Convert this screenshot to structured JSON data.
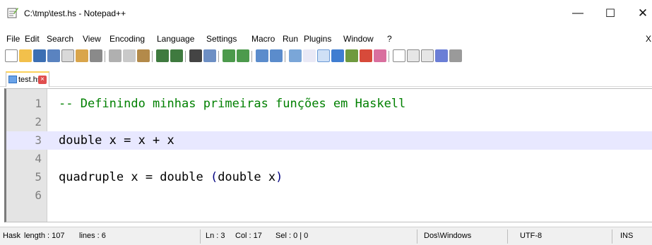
{
  "window": {
    "title": "C:\\tmp\\test.hs - Notepad++",
    "minimize_glyph": "—",
    "maximize_glyph": "☐",
    "close_glyph": "✕"
  },
  "menu": {
    "items": [
      "File",
      "Edit",
      "Search",
      "View",
      "Encoding",
      "Language",
      "Settings",
      "Macro",
      "Run",
      "Plugins",
      "Window",
      "?"
    ],
    "close_doc": "X"
  },
  "toolbar": {
    "icons": [
      "new-file-icon",
      "open-file-icon",
      "save-icon",
      "save-all-icon",
      "close-icon",
      "close-all-icon",
      "print-icon",
      "cut-icon",
      "copy-icon",
      "paste-icon",
      "undo-icon",
      "redo-icon",
      "find-icon",
      "replace-icon",
      "zoom-in-icon",
      "zoom-out-icon",
      "sync-vertical-icon",
      "sync-horizontal-icon",
      "word-wrap-icon",
      "show-all-chars-icon",
      "indent-guide-icon",
      "doc-map-icon",
      "function-list-icon",
      "folder-workspace-icon",
      "record-macro-icon",
      "stop-macro-icon",
      "play-macro-icon",
      "run-macro-multiple-icon",
      "save-macro-icon"
    ]
  },
  "tab": {
    "label": "test.hs",
    "close_glyph": "×"
  },
  "editor": {
    "lines": [
      {
        "num": "1",
        "code": "-- Definindo minhas primeiras funções em Haskell"
      },
      {
        "num": "2",
        "code": ""
      },
      {
        "num": "3",
        "code": "double x = x + x"
      },
      {
        "num": "4",
        "code": ""
      },
      {
        "num": "5",
        "code_a": "quadruple x = double ",
        "code_b": "(",
        "code_c": "double x",
        "code_d": ")"
      },
      {
        "num": "6",
        "code": ""
      }
    ]
  },
  "status": {
    "language": "Hask",
    "length": "length : 107",
    "lines": "lines : 6",
    "ln": "Ln : 3",
    "col": "Col : 17",
    "sel": "Sel : 0 | 0",
    "eol": "Dos\\Windows",
    "encoding": "UTF-8",
    "mode": "INS"
  },
  "colors": {
    "comment": "#008000",
    "current_line": "#e8e8ff",
    "gutter": "#e4e4e4",
    "tab_accent": "#fbd25c"
  }
}
